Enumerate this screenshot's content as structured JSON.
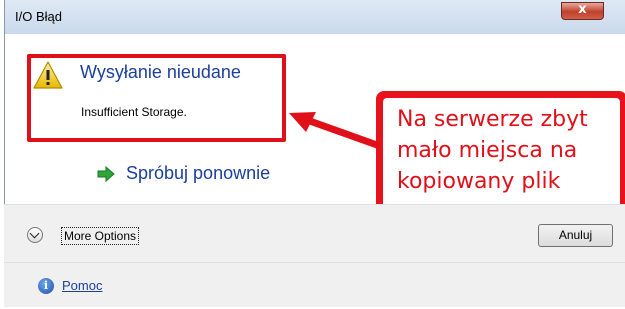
{
  "window": {
    "title": "I/O Błąd",
    "close_label": "x"
  },
  "message": {
    "title": "Wysyłanie nieudane",
    "detail": "Insufficient Storage.",
    "retry_label": "Spróbuj ponownie"
  },
  "annotation": {
    "callout_text": "Na serwerze zbyt mało miejsca na kopiowany plik",
    "color": "#e0101b"
  },
  "footer": {
    "more_options_label": "More Options",
    "cancel_label": "Anuluj",
    "help_label": "Pomoc"
  },
  "icons": {
    "warning": "warning-icon",
    "retry": "green-arrow-icon",
    "expand": "chevron-down-icon",
    "help": "info-icon"
  },
  "colors": {
    "link_blue": "#1a3f9c",
    "footer_bg": "#f0f0f0",
    "close_red": "#c0412e"
  }
}
